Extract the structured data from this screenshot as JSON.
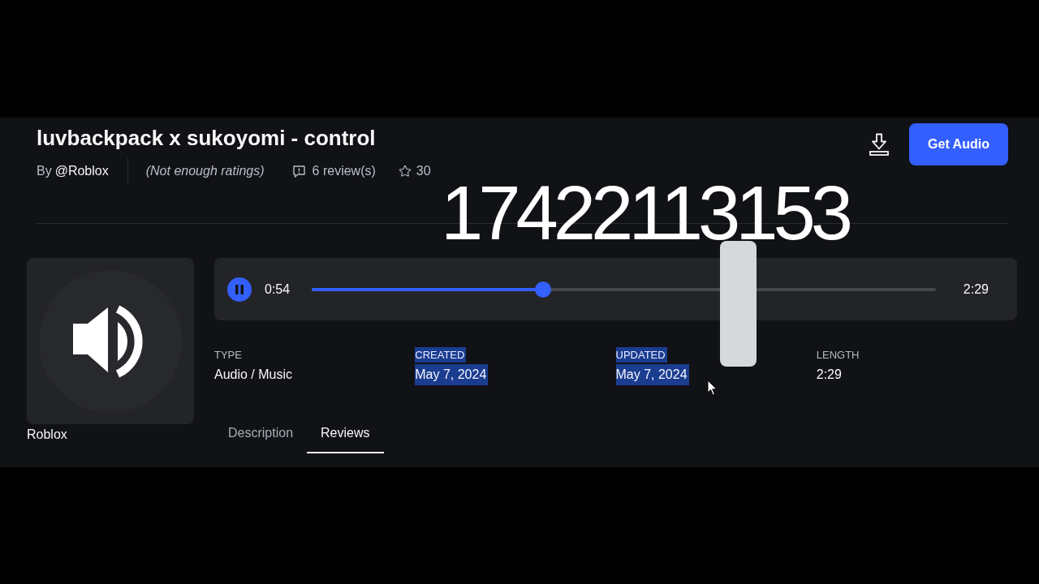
{
  "asset": {
    "title": "luvbackpack x sukoyomi - control",
    "by_label": "By",
    "creator": "@Roblox",
    "rating": "(Not enough ratings)",
    "reviews": "6 review(s)",
    "favorites": "30"
  },
  "actions": {
    "get_audio": "Get Audio"
  },
  "overlay_caption": "17422113153",
  "thumbnail": {
    "caption": "Roblox"
  },
  "player": {
    "playing": true,
    "elapsed": "0:54",
    "level": 0.37,
    "duration": "2:29"
  },
  "details": [
    {
      "label": "TYPE",
      "value": "Audio / Music",
      "highlighted": false
    },
    {
      "label": "CREATED",
      "value": "May 7, 2024",
      "highlighted": true
    },
    {
      "label": "UPDATED",
      "value": "May 7, 2024",
      "highlighted": true
    },
    {
      "label": "LENGTH",
      "value": "2:29",
      "highlighted": false
    }
  ],
  "tabs": [
    {
      "label": "Description",
      "selected": false
    },
    {
      "label": "Reviews",
      "selected": true
    }
  ]
}
